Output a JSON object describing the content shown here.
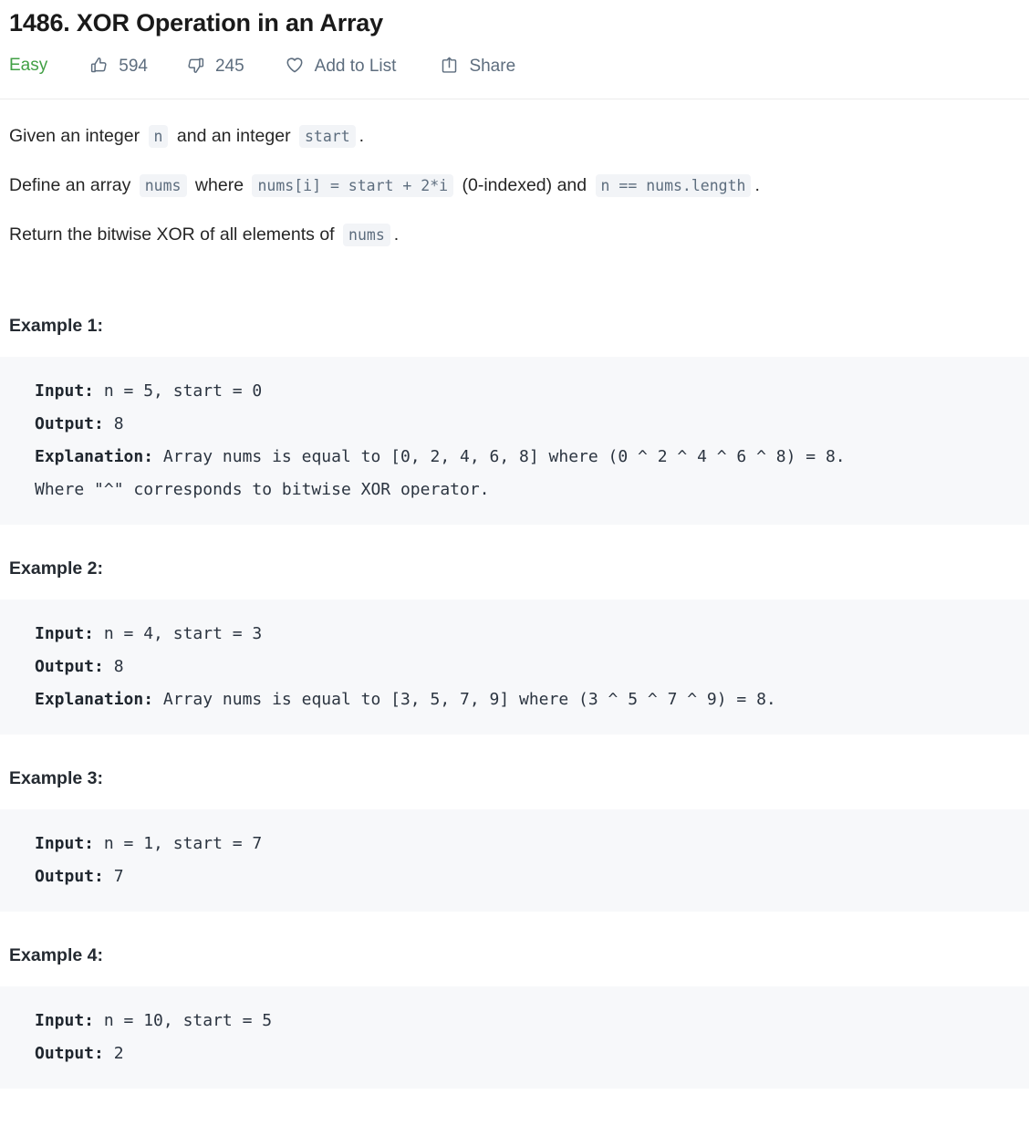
{
  "problem": {
    "title": "1486. XOR Operation in an Array",
    "difficulty": "Easy",
    "difficulty_color": "#42a045"
  },
  "meta": {
    "upvotes": "594",
    "downvotes": "245",
    "add_to_list_label": "Add to List",
    "share_label": "Share",
    "icons": {
      "upvote": "thumbs-up-icon",
      "downvote": "thumbs-down-icon",
      "favorite": "heart-icon",
      "share": "share-icon"
    }
  },
  "description": {
    "p1": {
      "t1": "Given an integer",
      "code1": "n",
      "t2": "and an integer",
      "code2": "start",
      "t3": "."
    },
    "p2": {
      "t1": "Define an array",
      "code1": "nums",
      "t2": "where",
      "code2": "nums[i] = start + 2*i",
      "t3": "(0-indexed) and",
      "code3": "n == nums.length",
      "t4": "."
    },
    "p3": {
      "t1": "Return the bitwise XOR of all elements of",
      "code1": "nums",
      "t2": "."
    }
  },
  "examples": [
    {
      "heading": "Example 1:",
      "input_label": "Input:",
      "input_value": " n = 5, start = 0",
      "output_label": "Output:",
      "output_value": " 8",
      "explanation_label": "Explanation:",
      "explanation_value": " Array nums is equal to [0, 2, 4, 6, 8] where (0 ^ 2 ^ 4 ^ 6 ^ 8) = 8.\nWhere \"^\" corresponds to bitwise XOR operator."
    },
    {
      "heading": "Example 2:",
      "input_label": "Input:",
      "input_value": " n = 4, start = 3",
      "output_label": "Output:",
      "output_value": " 8",
      "explanation_label": "Explanation:",
      "explanation_value": " Array nums is equal to [3, 5, 7, 9] where (3 ^ 5 ^ 7 ^ 9) = 8."
    },
    {
      "heading": "Example 3:",
      "input_label": "Input:",
      "input_value": " n = 1, start = 7",
      "output_label": "Output:",
      "output_value": " 7",
      "explanation_label": "",
      "explanation_value": ""
    },
    {
      "heading": "Example 4:",
      "input_label": "Input:",
      "input_value": " n = 10, start = 5",
      "output_label": "Output:",
      "output_value": " 2",
      "explanation_label": "",
      "explanation_value": ""
    }
  ]
}
